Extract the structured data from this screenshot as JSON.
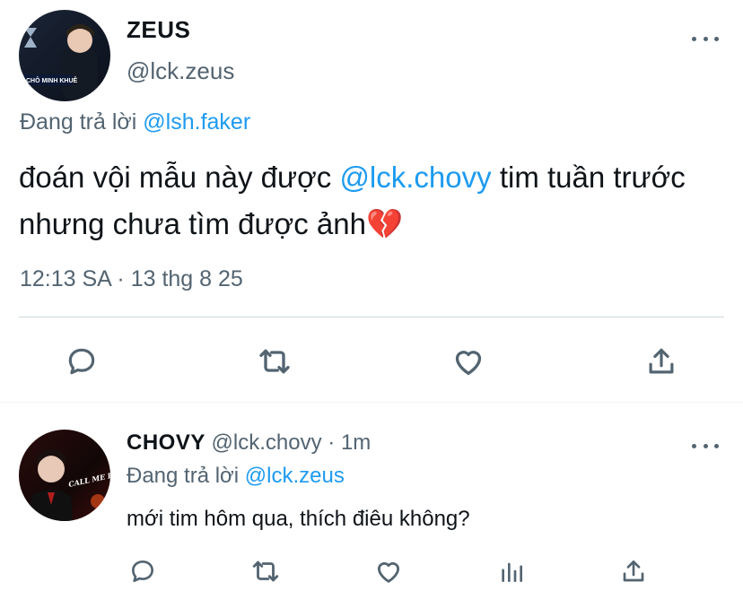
{
  "main_tweet": {
    "display_name": "ZEUS",
    "handle": "@lck.zeus",
    "avatar_caption": "CHÔ MINH KHUÊ",
    "replying_prefix": "Đang trả lời",
    "replying_to": "@lsh.faker",
    "text_before_mention": "đoán vội mẫu này được ",
    "mention": "@lck.chovy",
    "text_after_mention": " tim tuần trước nhưng chưa tìm được ảnh",
    "emoji": "💔",
    "timestamp": "12:13 SA · 13 thg 8 25"
  },
  "reply_tweet": {
    "display_name": "CHOVY",
    "handle": "@lck.chovy",
    "separator": "·",
    "age": "1m",
    "replying_prefix": "Đang trả lời",
    "replying_to": "@lck.zeus",
    "text": "mới tim hôm qua, thích điêu không?",
    "avatar_caption": "CALL ME BY FIRE"
  },
  "colors": {
    "text": "#0f1419",
    "muted": "#536471",
    "link": "#1d9bf0",
    "divider": "#cfd9de",
    "emoji_heart": "#e0245e"
  }
}
